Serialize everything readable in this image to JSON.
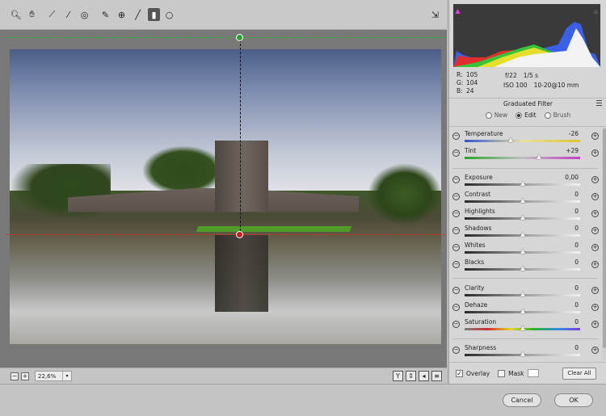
{
  "toolbar": {
    "tools": [
      {
        "name": "zoom",
        "glyph": "🔍︎",
        "active": false
      },
      {
        "name": "hand",
        "glyph": "✋︎",
        "active": false
      },
      {
        "name": "white-balance",
        "glyph": "⟋",
        "active": false
      },
      {
        "name": "color-sampler",
        "glyph": "⁄",
        "active": false
      },
      {
        "name": "targeted-adjustment",
        "glyph": "◎",
        "active": false
      },
      {
        "name": "spot-removal",
        "glyph": "✎",
        "active": false
      },
      {
        "name": "red-eye",
        "glyph": "⊕",
        "active": false
      },
      {
        "name": "adjustment-brush",
        "glyph": "╱",
        "active": false
      },
      {
        "name": "graduated-filter",
        "glyph": "▮",
        "active": true
      },
      {
        "name": "radial-filter",
        "glyph": "○",
        "active": false
      }
    ],
    "fullscreen_glyph": "⇲"
  },
  "canvas": {
    "zoom": "22,6%"
  },
  "readout": {
    "r_label": "R:",
    "r": "105",
    "g_label": "G:",
    "g": "104",
    "b_label": "B:",
    "b": "24",
    "aperture": "f/22",
    "shutter": "1/5 s",
    "iso": "ISO 100",
    "lens": "10-20@10 mm"
  },
  "panel": {
    "title": "Graduated Filter",
    "modes": [
      {
        "label": "New",
        "selected": false
      },
      {
        "label": "Edit",
        "selected": true
      },
      {
        "label": "Brush",
        "selected": false
      }
    ],
    "overlay_label": "Overlay",
    "overlay_checked": true,
    "mask_label": "Mask",
    "mask_checked": false,
    "clear_all": "Clear All"
  },
  "sliders": [
    {
      "label": "Temperature",
      "value": "-26",
      "position": 0.4,
      "track": "temp"
    },
    {
      "label": "Tint",
      "value": "+29",
      "position": 0.64,
      "track": "tint"
    },
    {
      "label": "Exposure",
      "value": "0,00",
      "position": 0.5,
      "track": "gray"
    },
    {
      "label": "Contrast",
      "value": "0",
      "position": 0.5,
      "track": "gray"
    },
    {
      "label": "Highlights",
      "value": "0",
      "position": 0.5,
      "track": "gray"
    },
    {
      "label": "Shadows",
      "value": "0",
      "position": 0.5,
      "track": "gray"
    },
    {
      "label": "Whites",
      "value": "0",
      "position": 0.5,
      "track": "gray"
    },
    {
      "label": "Blacks",
      "value": "0",
      "position": 0.5,
      "track": "gray"
    },
    {
      "label": "Clarity",
      "value": "0",
      "position": 0.5,
      "track": "gray"
    },
    {
      "label": "Dehaze",
      "value": "0",
      "position": 0.5,
      "track": "gray"
    },
    {
      "label": "Saturation",
      "value": "0",
      "position": 0.5,
      "track": "sat"
    },
    {
      "label": "Sharpness",
      "value": "0",
      "position": 0.5,
      "track": "gray"
    }
  ],
  "dialog": {
    "cancel": "Cancel",
    "ok": "OK"
  }
}
